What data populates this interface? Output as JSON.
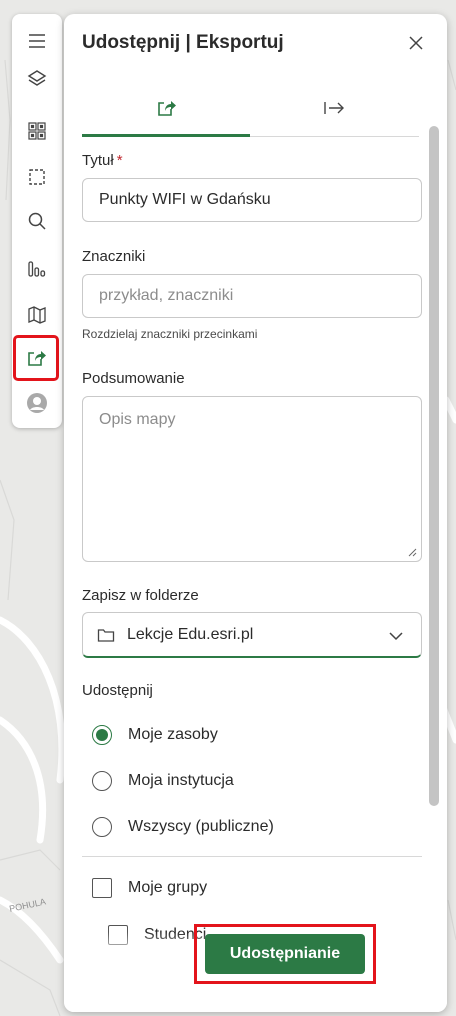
{
  "map": {
    "label": "POHULA",
    "colors": {
      "background": "#e9e9e7",
      "road": "#ffffff"
    }
  },
  "toolbar": {
    "items": [
      {
        "icon": "menu-icon"
      },
      {
        "icon": "layers-icon"
      },
      {
        "icon": "qr-grid-icon"
      },
      {
        "icon": "selection-frame-icon"
      },
      {
        "icon": "search-icon"
      },
      {
        "icon": "chart-icon"
      },
      {
        "icon": "map-icon"
      },
      {
        "icon": "share-icon",
        "active": true
      },
      {
        "icon": "user-avatar-icon"
      }
    ]
  },
  "panel": {
    "title": "Udostępnij | Eksportuj",
    "tabs": [
      {
        "icon": "share-export-icon",
        "active": true
      },
      {
        "icon": "export-arrow-icon",
        "active": false
      }
    ],
    "form": {
      "title_label": "Tytuł",
      "title_required": "*",
      "title_value": "Punkty WIFI w Gdańsku",
      "tags_label": "Znaczniki",
      "tags_placeholder": "przykład, znaczniki",
      "tags_hint": "Rozdzielaj znaczniki przecinkami",
      "summary_label": "Podsumowanie",
      "summary_placeholder": "Opis mapy",
      "folder_label": "Zapisz w folderze",
      "folder_value": "Lekcje Edu.esri.pl",
      "share_label": "Udostępnij",
      "share_options": [
        {
          "label": "Moje zasoby",
          "checked": true
        },
        {
          "label": "Moja instytucja",
          "checked": false
        },
        {
          "label": "Wszyscy (publiczne)",
          "checked": false
        }
      ],
      "groups_label": "Moje grupy",
      "groups": [
        {
          "label": "Studenci",
          "checked": false
        }
      ]
    },
    "share_button": "Udostępnianie"
  },
  "colors": {
    "accent": "#2c7a45",
    "highlight": "#e3141b",
    "required": "#c0262d"
  }
}
